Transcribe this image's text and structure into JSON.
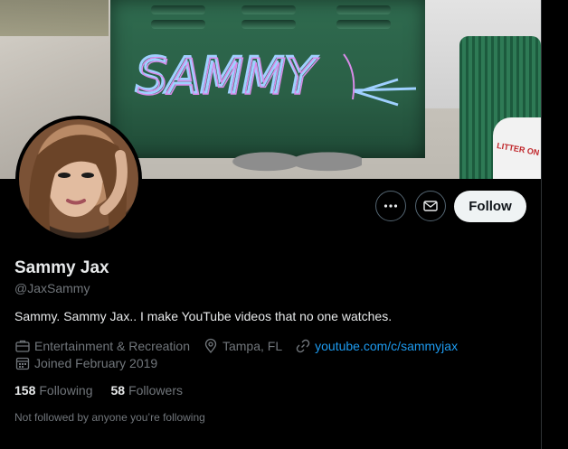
{
  "banner": {
    "graffiti_text": "SAMMY",
    "sign_text": "LITTER ON"
  },
  "profile": {
    "name": "Sammy Jax",
    "handle": "@JaxSammy",
    "bio": "Sammy. Sammy Jax.. I make YouTube videos that no one watches.",
    "category": "Entertainment & Recreation",
    "location": "Tampa, FL",
    "website": "youtube.com/c/sammyjax",
    "joined": "Joined February 2019",
    "following_count": "158",
    "following_label": "Following",
    "followers_count": "58",
    "followers_label": "Followers",
    "followed_note": "Not followed by anyone you’re following"
  },
  "actions": {
    "more_icon": "more-icon",
    "message_icon": "mail-icon",
    "follow_label": "Follow"
  },
  "colors": {
    "background": "#000000",
    "text_primary": "#e7e9ea",
    "text_secondary": "#71767b",
    "link": "#1d9bf0",
    "follow_bg": "#eff3f4"
  }
}
